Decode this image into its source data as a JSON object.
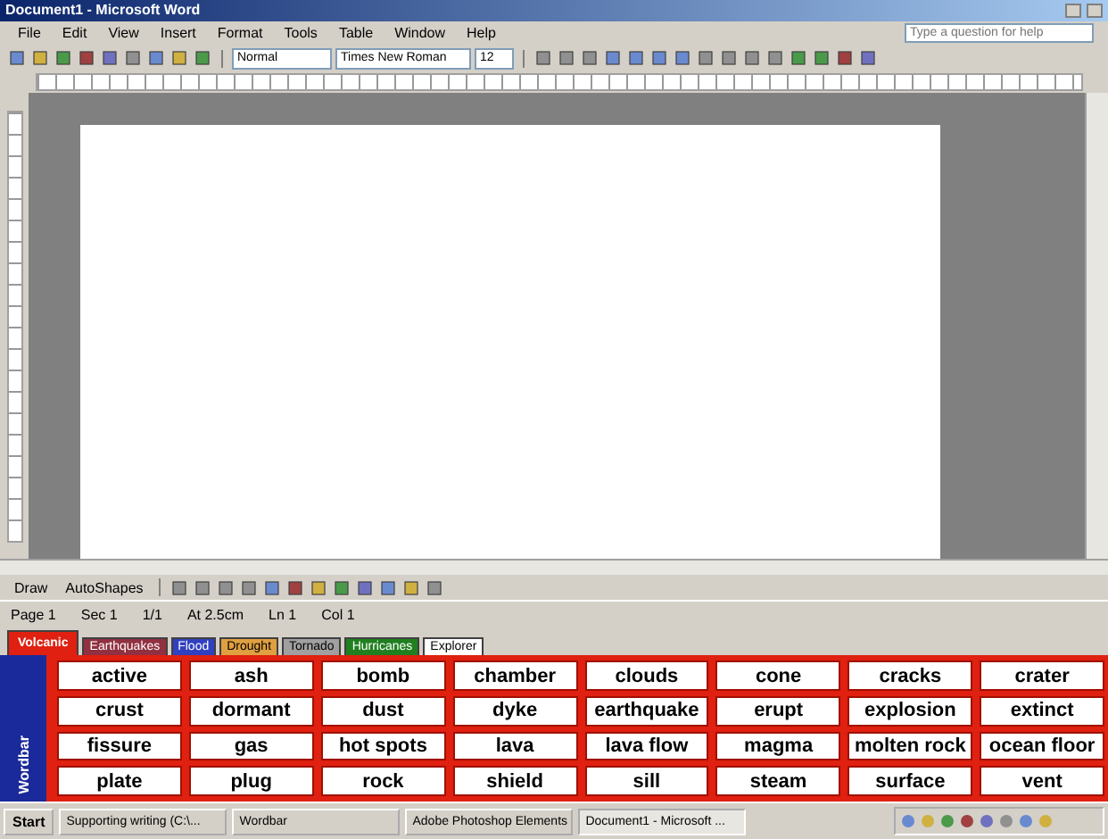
{
  "window": {
    "title": "Document1 - Microsoft Word"
  },
  "menu": [
    "File",
    "Edit",
    "View",
    "Insert",
    "Format",
    "Tools",
    "Table",
    "Window",
    "Help"
  ],
  "help_box": {
    "placeholder": "Type a question for help"
  },
  "formatting": {
    "style": "Normal",
    "font": "Times New Roman",
    "size": "12"
  },
  "draw_toolbar": [
    "Draw",
    "AutoShapes"
  ],
  "status_bar": [
    "Page 1",
    "Sec 1",
    "1/1",
    "At 2.5cm",
    "Ln 1",
    "Col 1"
  ],
  "wordbar": {
    "title": "Wordbar",
    "tabs": [
      {
        "label": "Volcanic",
        "color": "#e02010",
        "selected": true
      },
      {
        "label": "Earthquakes",
        "color": "#903040",
        "selected": false
      },
      {
        "label": "Flood",
        "color": "#3040c0",
        "selected": false
      },
      {
        "label": "Drought",
        "color": "#e0a040",
        "selected": false
      },
      {
        "label": "Tornado",
        "color": "#a0a0a0",
        "selected": false
      },
      {
        "label": "Hurricanes",
        "color": "#208020",
        "selected": false
      },
      {
        "label": "Explorer",
        "color": "#ffffff",
        "selected": false
      }
    ],
    "words": [
      [
        "active",
        "ash",
        "bomb",
        "chamber",
        "clouds",
        "cone",
        "cracks",
        "crater"
      ],
      [
        "crust",
        "dormant",
        "dust",
        "dyke",
        "earthquake",
        "erupt",
        "explosion",
        "extinct"
      ],
      [
        "fissure",
        "gas",
        "hot spots",
        "lava",
        "lava flow",
        "magma",
        "molten rock",
        "ocean floor"
      ],
      [
        "plate",
        "plug",
        "rock",
        "shield",
        "sill",
        "steam",
        "surface",
        "vent"
      ]
    ]
  },
  "taskbar": {
    "start": "Start",
    "tasks": [
      {
        "label": "Supporting writing (C:\\...",
        "selected": false
      },
      {
        "label": "Wordbar",
        "selected": false
      },
      {
        "label": "Adobe Photoshop Elements",
        "selected": false
      },
      {
        "label": "Document1 - Microsoft ...",
        "selected": true
      }
    ]
  }
}
